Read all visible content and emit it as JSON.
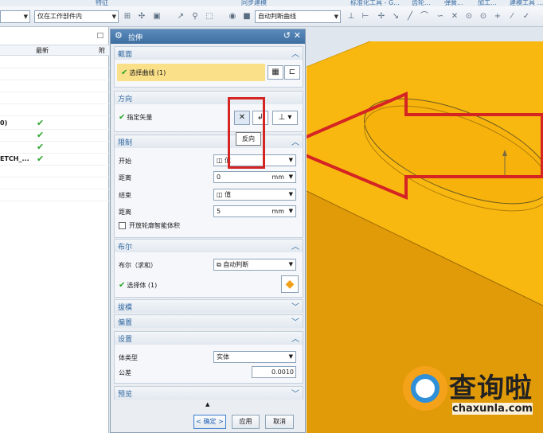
{
  "ribbon": {
    "labels": [
      "特征",
      "同步建模",
      "标准化工具 - G...",
      "齿轮...",
      "弹簧...",
      "加工...",
      "建模工具 ..."
    ]
  },
  "toolbar": {
    "filter_value": "",
    "scope_value": "仅在工作部件内",
    "curve_rule_value": "自动判断曲线"
  },
  "navigator": {
    "column_latest": "最新",
    "column_extra": "附",
    "rows": [
      {
        "text": "0)",
        "checked": true
      },
      {
        "text": "",
        "checked": true
      },
      {
        "text": "",
        "checked": true
      },
      {
        "text": "ETCH_...",
        "checked": true
      }
    ]
  },
  "dialog": {
    "title": "拉伸",
    "section": {
      "heading": "截面",
      "select_curve": "选择曲线 (1)"
    },
    "direction": {
      "heading": "方向",
      "specify_vector": "指定矢量",
      "tooltip": "反向"
    },
    "limits": {
      "heading": "限制",
      "start_label": "开始",
      "start_value": "值",
      "distance1_label": "距离",
      "distance1_value": "0",
      "distance1_unit": "mm",
      "end_label": "结束",
      "end_value": "值",
      "distance2_label": "距离",
      "distance2_value": "5",
      "distance2_unit": "mm",
      "open_profile": "开放轮廓智能体积"
    },
    "boolean": {
      "heading": "布尔",
      "label": "布尔（求和）",
      "value": "自动判断",
      "select_body": "选择体 (1)"
    },
    "draft": {
      "heading": "拔模"
    },
    "offset": {
      "heading": "偏置"
    },
    "settings": {
      "heading": "设置",
      "body_type_label": "体类型",
      "body_type_value": "实体",
      "tolerance_label": "公差",
      "tolerance_value": "0.0010"
    },
    "preview": {
      "heading": "预览"
    },
    "buttons": {
      "ok": "< 确定 >",
      "apply": "应用",
      "cancel": "取消"
    }
  },
  "watermark": {
    "text": "查询啦",
    "url": "chaxunla.com"
  },
  "colors": {
    "accent": "#2f66a0",
    "highlight_yellow": "#fbe08a",
    "part_yellow": "#f9b810",
    "arrow_red": "#d42424",
    "check_green": "#2aa52a"
  }
}
